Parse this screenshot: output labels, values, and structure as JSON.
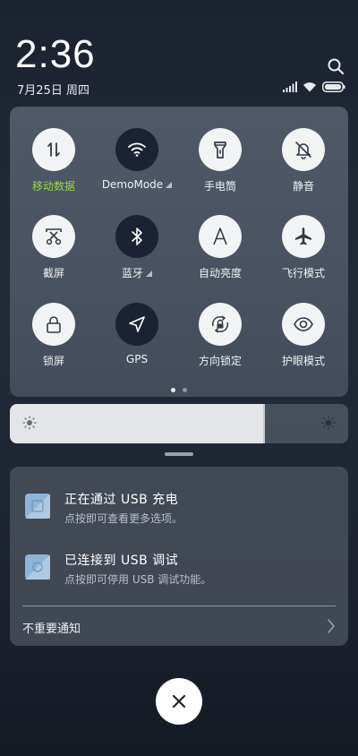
{
  "header": {
    "time": "2:36",
    "date": "7月25日 周四"
  },
  "quick_settings": {
    "tiles": [
      {
        "id": "mobile-data",
        "label": "移动数据",
        "state": "on",
        "icon": "data-arrows-icon"
      },
      {
        "id": "wifi",
        "label": "DemoMode",
        "state": "active",
        "icon": "wifi-icon"
      },
      {
        "id": "flashlight",
        "label": "手电筒",
        "state": "on",
        "icon": "flashlight-icon"
      },
      {
        "id": "mute",
        "label": "静音",
        "state": "on",
        "icon": "bell-off-icon"
      },
      {
        "id": "screenshot",
        "label": "截屏",
        "state": "on",
        "icon": "scissors-icon"
      },
      {
        "id": "bluetooth",
        "label": "蓝牙",
        "state": "active",
        "icon": "bluetooth-icon"
      },
      {
        "id": "auto-brightness",
        "label": "自动亮度",
        "state": "on",
        "icon": "letter-a-icon"
      },
      {
        "id": "airplane",
        "label": "飞行模式",
        "state": "on",
        "icon": "airplane-icon"
      },
      {
        "id": "lock-screen",
        "label": "锁屏",
        "state": "on",
        "icon": "lock-icon"
      },
      {
        "id": "gps",
        "label": "GPS",
        "state": "active",
        "icon": "navigation-icon"
      },
      {
        "id": "rotation-lock",
        "label": "方向锁定",
        "state": "on",
        "icon": "rotation-lock-icon"
      },
      {
        "id": "eye-care",
        "label": "护眼模式",
        "state": "on",
        "icon": "eye-icon"
      }
    ],
    "page_count": 2,
    "current_page": 1
  },
  "brightness": {
    "level": 0.75
  },
  "notifications": {
    "items": [
      {
        "title": "正在通过 USB 充电",
        "subtitle": "点按即可查看更多选项。"
      },
      {
        "title": "已连接到 USB 调试",
        "subtitle": "点按即可停用 USB 调试功能。"
      }
    ],
    "unimportant_label": "不重要通知"
  },
  "colors": {
    "accent_green": "#9bd54a",
    "tile_on": "#f2f3f5",
    "tile_active": "#1a2233"
  }
}
